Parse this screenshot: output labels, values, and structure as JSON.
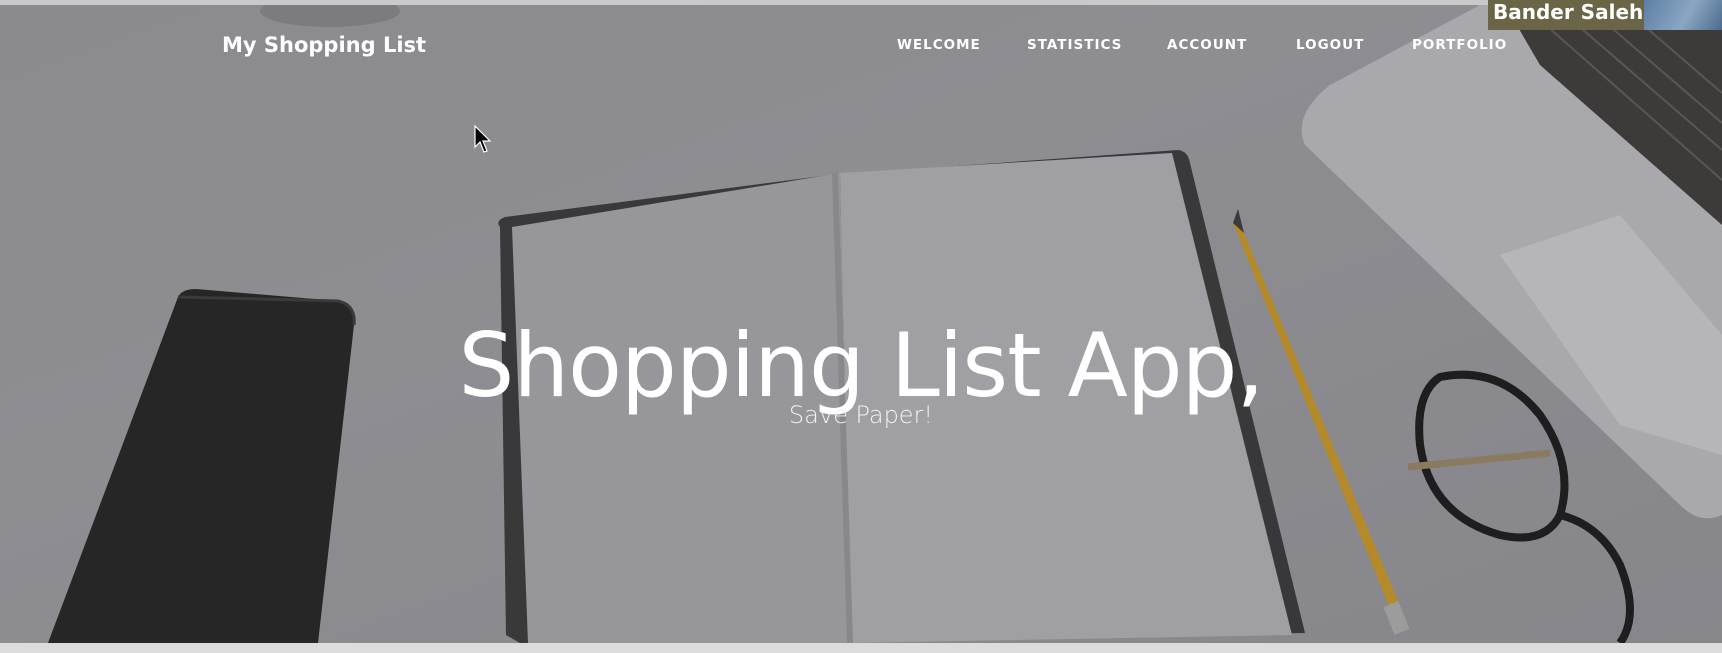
{
  "navbar": {
    "brand": "My Shopping List",
    "links": [
      "WELCOME",
      "STATISTICS",
      "ACCOUNT",
      "LOGOUT",
      "PORTFOLIO"
    ]
  },
  "hero": {
    "title": "Shopping List App,",
    "subtitle": "Save Paper!"
  },
  "overlay": {
    "presenter_name": "Bander Saleh"
  },
  "icons": {
    "cursor": "mouse-pointer-icon"
  },
  "colors": {
    "hero_overlay": "#8b8b8f",
    "nav_text": "#ffffff",
    "name_tag_bg": "#6a6546"
  }
}
